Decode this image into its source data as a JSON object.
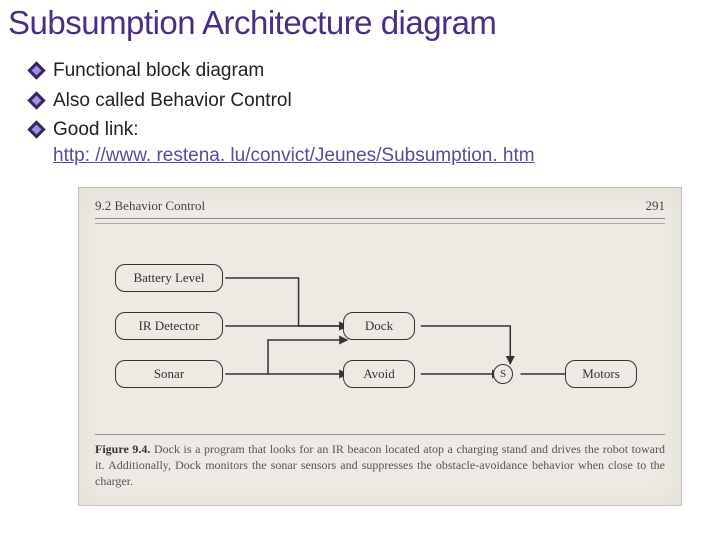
{
  "title": "Subsumption Architecture diagram",
  "bullets": {
    "b1": "Functional block diagram",
    "b2": "Also called Behavior Control",
    "b3": "Good link:",
    "link": "http: //www. restena. lu/convict/Jeunes/Subsumption. htm"
  },
  "figure": {
    "section": "9.2 Behavior Control",
    "page": "291",
    "nodes": {
      "battery": "Battery Level",
      "ir": "IR Detector",
      "sonar": "Sonar",
      "dock": "Dock",
      "avoid": "Avoid",
      "s": "S",
      "motors": "Motors"
    },
    "caption_label": "Figure 9.4.",
    "caption_text": "Dock is a program that looks for an IR beacon located atop a charging stand and drives the robot toward it. Additionally, Dock monitors the sonar sensors and suppresses the obstacle-avoidance behavior when close to the charger."
  }
}
